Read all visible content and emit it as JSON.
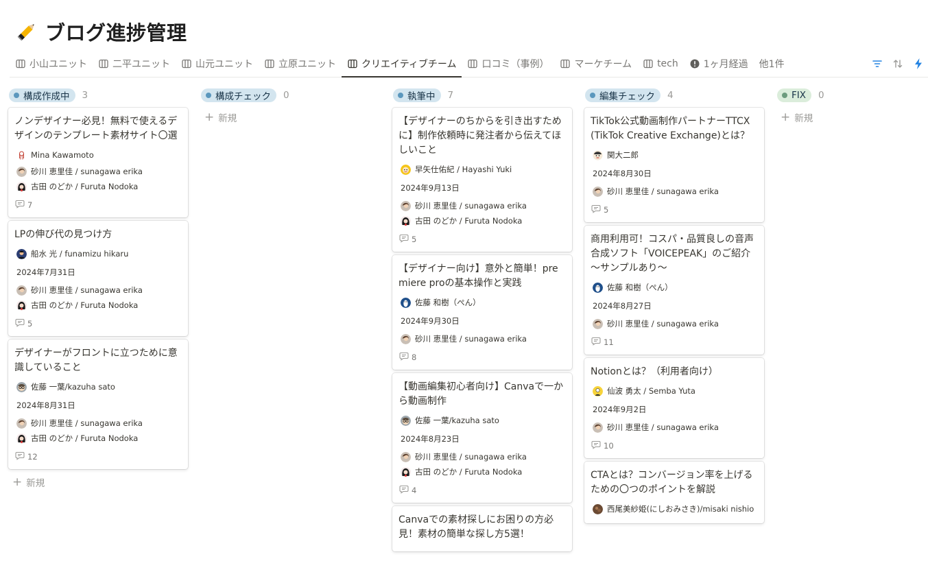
{
  "page": {
    "title": "ブログ進捗管理",
    "icon": "pencil-icon"
  },
  "tabs": [
    {
      "label": "小山ユニット",
      "icon": "board-view-icon",
      "active": false
    },
    {
      "label": "二平ユニット",
      "icon": "board-view-icon",
      "active": false
    },
    {
      "label": "山元ユニット",
      "icon": "board-view-icon",
      "active": false
    },
    {
      "label": "立原ユニット",
      "icon": "board-view-icon",
      "active": false
    },
    {
      "label": "クリエイティブチーム",
      "icon": "board-view-icon",
      "active": true
    },
    {
      "label": "口コミ（事例）",
      "icon": "board-view-icon",
      "active": false
    },
    {
      "label": "マーケチーム",
      "icon": "board-view-icon",
      "active": false
    },
    {
      "label": "tech",
      "icon": "board-view-icon",
      "active": false
    },
    {
      "label": "1ヶ月経過",
      "icon": "alert-circle-icon",
      "active": false
    }
  ],
  "tabs_more": "他1件",
  "toolbar": {
    "filter_icon": "filter-icon",
    "sort_icon": "sort-icon",
    "automation_icon": "lightning-icon"
  },
  "colors": {
    "accent_blue": "#2383e2",
    "pill_blue_bg": "#d3e5ef",
    "pill_blue_dot": "#5b97bd",
    "pill_green_bg": "#dbeddb",
    "pill_green_dot": "#6c9b7d"
  },
  "new_label": "新規",
  "columns": [
    {
      "status": "構成作成中",
      "count": "3",
      "color": "blue",
      "cards": [
        {
          "title": "ノンデザイナー必見！無料で使えるデザインのテンプレート素材サイト〇選",
          "author": "Mina Kawamoto",
          "author_avatar": "woman-outline",
          "date": "",
          "reviewers": [
            "砂川 恵里佳 / sunagawa erika",
            "古田 のどか / Furuta Nodoka"
          ],
          "comments": "7"
        },
        {
          "title": "LPの伸び代の見つけ方",
          "author": "船水 光 / funamizu hikaru",
          "author_avatar": "man-dark",
          "date": "2024年7月31日",
          "reviewers": [
            "砂川 恵里佳 / sunagawa erika",
            "古田 のどか / Furuta Nodoka"
          ],
          "comments": "5"
        },
        {
          "title": "デザイナーがフロントに立つために意識していること",
          "author": "佐藤 一葉/kazuha sato",
          "author_avatar": "glasses",
          "date": "2024年8月31日",
          "reviewers": [
            "砂川 恵里佳 / sunagawa erika",
            "古田 のどか / Furuta Nodoka"
          ],
          "comments": "12"
        }
      ],
      "show_new_after": true
    },
    {
      "status": "構成チェック",
      "count": "0",
      "color": "blue",
      "cards": [],
      "show_new_after": true
    },
    {
      "status": "執筆中",
      "count": "7",
      "color": "blue",
      "cards": [
        {
          "title": "【デザイナーのちからを引き出すために】制作依頼時に発注者から伝えてほしいこと",
          "author": "早矢仕佑紀 / Hayashi Yuki",
          "author_avatar": "yellow-face",
          "date": "2024年9月13日",
          "reviewers": [
            "砂川 恵里佳 / sunagawa erika",
            "古田 のどか / Furuta Nodoka"
          ],
          "comments": "5"
        },
        {
          "title": "【デザイナー向け】意外と簡単！premiere proの基本操作と実践",
          "author": "佐藤 和樹（ぺん）",
          "author_avatar": "penguin",
          "date": "2024年9月30日",
          "reviewers": [
            "砂川 恵里佳 / sunagawa erika"
          ],
          "comments": "8"
        },
        {
          "title": "【動画編集初心者向け】Canvaで一から動画制作",
          "author": "佐藤 一葉/kazuha sato",
          "author_avatar": "glasses",
          "date": "2024年8月23日",
          "reviewers": [
            "砂川 恵里佳 / sunagawa erika",
            "古田 のどか / Furuta Nodoka"
          ],
          "comments": "4"
        },
        {
          "title": "Canvaでの素材探しにお困りの方必見！素材の簡単な探し方5選！",
          "author": "",
          "author_avatar": "",
          "date": "",
          "reviewers": [],
          "comments": ""
        }
      ],
      "show_new_after": false
    },
    {
      "status": "編集チェック",
      "count": "4",
      "color": "blue",
      "cards": [
        {
          "title": "TikTok公式動画制作パートナーTTCX(TikTok Creative Exchange)とは？",
          "author": "関大二郎",
          "author_avatar": "man-cartoon",
          "date": "2024年8月30日",
          "reviewers": [
            "砂川 恵里佳 / sunagawa erika"
          ],
          "comments": "5"
        },
        {
          "title": "商用利用可！コスパ・品質良しの音声合成ソフト「VOICEPEAK」のご紹介～サンプルあり～",
          "author": "佐藤 和樹（ぺん）",
          "author_avatar": "penguin",
          "date": "2024年8月27日",
          "reviewers": [
            "砂川 恵里佳 / sunagawa erika"
          ],
          "comments": "11"
        },
        {
          "title": "Notionとは？（利用者向け）",
          "author": "仙波 勇太 / Semba Yuta",
          "author_avatar": "yellow-person",
          "date": "2024年9月2日",
          "reviewers": [
            "砂川 恵里佳 / sunagawa erika"
          ],
          "comments": "10"
        },
        {
          "title": "CTAとは？コンバージョン率を上げるための〇つのポイントを解説",
          "author": "西尾美紗姫(にしおみさき)/misaki nishio",
          "author_avatar": "brown-photo",
          "date": "",
          "reviewers": [],
          "comments": ""
        }
      ],
      "show_new_after": false
    },
    {
      "status": "FIX",
      "count": "0",
      "color": "green",
      "cards": [],
      "show_new_after": true
    }
  ]
}
